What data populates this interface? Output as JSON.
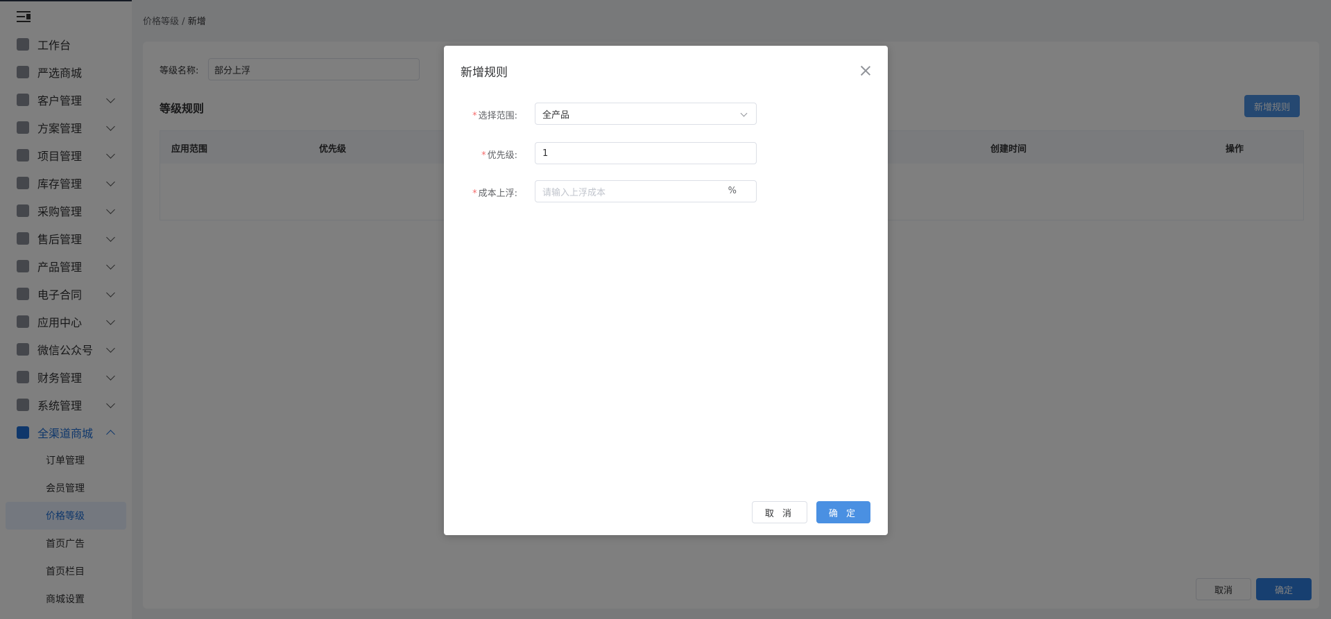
{
  "sidebar": {
    "items": [
      {
        "label": "工作台",
        "icon": "home-icon"
      },
      {
        "label": "严选商城",
        "icon": "chart-icon"
      },
      {
        "label": "客户管理",
        "icon": "user-icon"
      },
      {
        "label": "方案管理",
        "icon": "document-icon"
      },
      {
        "label": "项目管理",
        "icon": "folder-icon"
      },
      {
        "label": "库存管理",
        "icon": "boxes-icon"
      },
      {
        "label": "采购管理",
        "icon": "cart-icon"
      },
      {
        "label": "售后管理",
        "icon": "headset-icon"
      },
      {
        "label": "产品管理",
        "icon": "product-icon"
      },
      {
        "label": "电子合同",
        "icon": "contract-icon"
      },
      {
        "label": "应用中心",
        "icon": "apps-icon"
      },
      {
        "label": "微信公众号",
        "icon": "wechat-icon"
      },
      {
        "label": "财务管理",
        "icon": "money-bag-icon"
      },
      {
        "label": "系统管理",
        "icon": "settings-icon"
      },
      {
        "label": "全渠道商城",
        "icon": "mall-icon"
      }
    ],
    "sub_items": [
      {
        "label": "订单管理"
      },
      {
        "label": "会员管理"
      },
      {
        "label": "价格等级"
      },
      {
        "label": "首页广告"
      },
      {
        "label": "首页栏目"
      },
      {
        "label": "商城设置"
      }
    ]
  },
  "breadcrumb": {
    "parent": "价格等级",
    "separator": "/",
    "current": "新增"
  },
  "main": {
    "level_name_label": "等级名称:",
    "level_name_value": "部分上浮",
    "rules_title": "等级规则",
    "new_rule_button": "新增规则",
    "table_headers": [
      "应用范围",
      "优先级",
      "创建时间",
      "操作"
    ],
    "cancel_button": "取消",
    "confirm_button": "确定"
  },
  "dialog": {
    "title": "新增规则",
    "scope_label": "选择范围:",
    "scope_value": "全产品",
    "priority_label": "优先级:",
    "priority_value": "1",
    "cost_label": "成本上浮:",
    "cost_placeholder": "请输入上浮成本",
    "cost_suffix": "%",
    "required_mark": "*",
    "cancel_button": "取 消",
    "confirm_button": "确 定"
  },
  "colors": {
    "accent": "#4a90e2",
    "active_nav": "#1f6fd6",
    "required": "#f56c6c"
  }
}
